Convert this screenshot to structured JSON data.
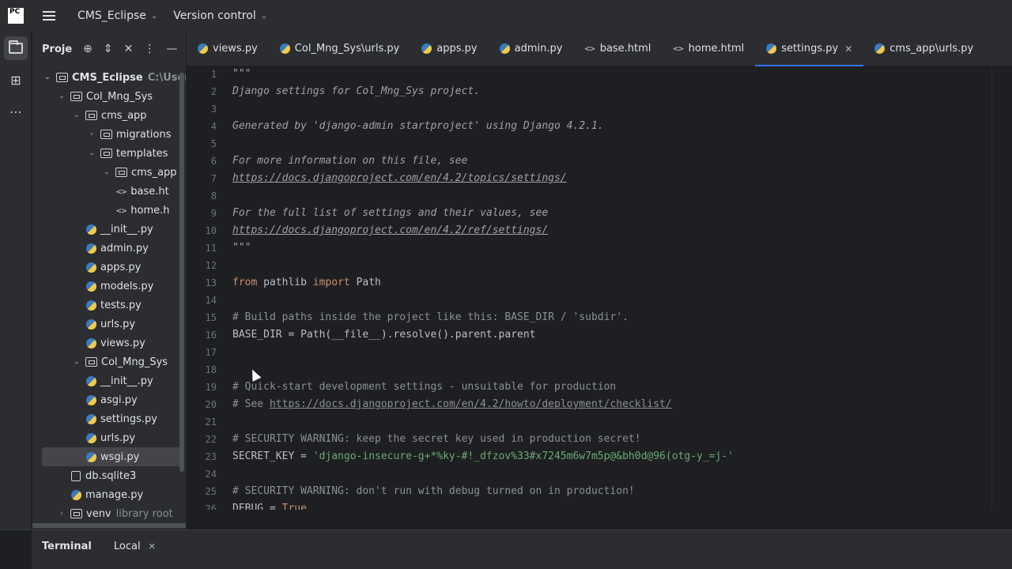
{
  "titlebar": {
    "logo": "PC",
    "project_name": "CMS_Eclipse",
    "vcs": "Version control"
  },
  "project_panel": {
    "title": "Proje",
    "tree": [
      {
        "label": "CMS_Eclipse",
        "hint": "C:\\Users",
        "kind": "folder",
        "expanded": true
      },
      {
        "label": "Col_Mng_Sys",
        "kind": "folder",
        "expanded": true
      },
      {
        "label": "cms_app",
        "kind": "folder",
        "expanded": true
      },
      {
        "label": "migrations",
        "kind": "folder",
        "expanded": false
      },
      {
        "label": "templates",
        "kind": "folder",
        "expanded": true
      },
      {
        "label": "cms_app",
        "kind": "folder",
        "expanded": true
      },
      {
        "label": "base.ht",
        "kind": "html"
      },
      {
        "label": "home.h",
        "kind": "html"
      },
      {
        "label": "__init__.py",
        "kind": "py"
      },
      {
        "label": "admin.py",
        "kind": "py"
      },
      {
        "label": "apps.py",
        "kind": "py"
      },
      {
        "label": "models.py",
        "kind": "py"
      },
      {
        "label": "tests.py",
        "kind": "py"
      },
      {
        "label": "urls.py",
        "kind": "py"
      },
      {
        "label": "views.py",
        "kind": "py"
      },
      {
        "label": "Col_Mng_Sys",
        "kind": "folder",
        "expanded": true
      },
      {
        "label": "__init__.py",
        "kind": "py"
      },
      {
        "label": "asgi.py",
        "kind": "py"
      },
      {
        "label": "settings.py",
        "kind": "py",
        "selected": true
      },
      {
        "label": "urls.py",
        "kind": "py"
      },
      {
        "label": "wsgi.py",
        "kind": "py"
      },
      {
        "label": "db.sqlite3",
        "kind": "db"
      },
      {
        "label": "manage.py",
        "kind": "py"
      },
      {
        "label": "venv",
        "hint": "library root",
        "kind": "folder",
        "expanded": false
      }
    ]
  },
  "tabs": [
    {
      "label": "views.py",
      "kind": "py"
    },
    {
      "label": "Col_Mng_Sys\\urls.py",
      "kind": "py"
    },
    {
      "label": "apps.py",
      "kind": "py"
    },
    {
      "label": "admin.py",
      "kind": "py"
    },
    {
      "label": "base.html",
      "kind": "html"
    },
    {
      "label": "home.html",
      "kind": "html"
    },
    {
      "label": "settings.py",
      "kind": "py",
      "active": true
    },
    {
      "label": "cms_app\\urls.py",
      "kind": "py"
    }
  ],
  "editor": {
    "lines": [
      {
        "n": "1",
        "parts": [
          {
            "t": "\"\"\"",
            "c": "doc"
          }
        ]
      },
      {
        "n": "2",
        "parts": [
          {
            "t": "Django settings for Col_Mng_Sys project.",
            "c": "doc"
          }
        ]
      },
      {
        "n": "3",
        "parts": []
      },
      {
        "n": "4",
        "parts": [
          {
            "t": "Generated by 'django-admin startproject' using Django 4.2.1.",
            "c": "doc"
          }
        ]
      },
      {
        "n": "5",
        "parts": []
      },
      {
        "n": "6",
        "parts": [
          {
            "t": "For more information on this file, see",
            "c": "doc"
          }
        ]
      },
      {
        "n": "7",
        "parts": [
          {
            "t": "https://docs.djangoproject.com/en/4.2/topics/settings/",
            "c": "link"
          }
        ]
      },
      {
        "n": "8",
        "parts": []
      },
      {
        "n": "9",
        "parts": [
          {
            "t": "For the full list of settings and their values, see",
            "c": "doc"
          }
        ]
      },
      {
        "n": "10",
        "parts": [
          {
            "t": "https://docs.djangoproject.com/en/4.2/ref/settings/",
            "c": "link"
          }
        ]
      },
      {
        "n": "11",
        "parts": [
          {
            "t": "\"\"\"",
            "c": "doc"
          }
        ]
      },
      {
        "n": "12",
        "parts": []
      },
      {
        "n": "13",
        "parts": [
          {
            "t": "from ",
            "c": "kw"
          },
          {
            "t": "pathlib ",
            "c": ""
          },
          {
            "t": "import ",
            "c": "kw"
          },
          {
            "t": "Path",
            "c": ""
          }
        ]
      },
      {
        "n": "14",
        "parts": []
      },
      {
        "n": "15",
        "parts": [
          {
            "t": "# Build paths inside the project like this: BASE_DIR / 'subdir'.",
            "c": "cm"
          }
        ]
      },
      {
        "n": "16",
        "parts": [
          {
            "t": "BASE_DIR = Path(__file__).resolve().parent.parent",
            "c": ""
          }
        ]
      },
      {
        "n": "17",
        "parts": []
      },
      {
        "n": "18",
        "parts": []
      },
      {
        "n": "19",
        "parts": [
          {
            "t": "# Quick-start development settings - unsuitable for production",
            "c": "cm"
          }
        ]
      },
      {
        "n": "20",
        "parts": [
          {
            "t": "# See ",
            "c": "cm"
          },
          {
            "t": "https://docs.djangoproject.com/en/4.2/howto/deployment/checklist/",
            "c": "cml"
          }
        ]
      },
      {
        "n": "21",
        "parts": []
      },
      {
        "n": "22",
        "parts": [
          {
            "t": "# SECURITY WARNING: keep the secret key used in production secret!",
            "c": "cm"
          }
        ]
      },
      {
        "n": "23",
        "parts": [
          {
            "t": "SECRET_KEY = ",
            "c": ""
          },
          {
            "t": "'django-insecure-g+*%ky-#!_dfzov%33#x7245m6w7m5p@&bh0d@96(otg-y_=j-'",
            "c": "str"
          }
        ]
      },
      {
        "n": "24",
        "parts": []
      },
      {
        "n": "25",
        "parts": [
          {
            "t": "# SECURITY WARNING: don't run with debug turned on in production!",
            "c": "cm"
          }
        ]
      },
      {
        "n": "26",
        "parts": [
          {
            "t": "DEBUG = ",
            "c": ""
          },
          {
            "t": "True",
            "c": "kw"
          }
        ]
      }
    ]
  },
  "terminal": {
    "title": "Terminal",
    "tab": "Local"
  },
  "colors": {
    "accent": "#3574f0",
    "background": "#1e1f22",
    "panel": "#2b2d30",
    "keyword": "#cf8e6d",
    "string": "#6aab73"
  }
}
